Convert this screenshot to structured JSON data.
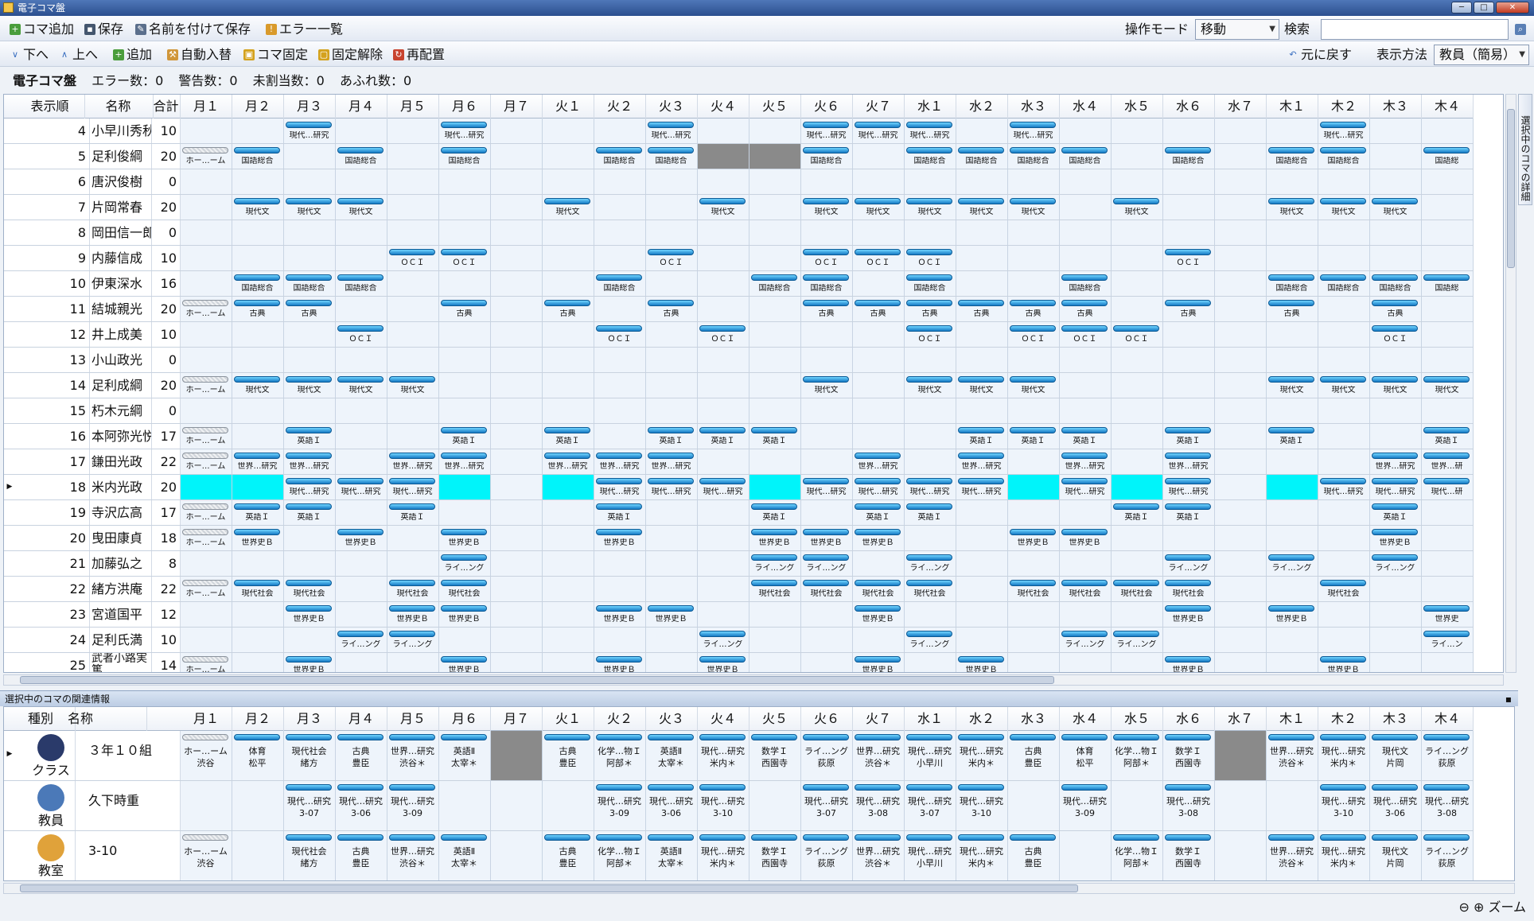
{
  "window": {
    "title": "電子コマ盤"
  },
  "toolbar1": {
    "add_piece": "コマ追加",
    "save": "保存",
    "save_as": "名前を付けて保存",
    "error_list": "エラー一覧",
    "mode_label": "操作モード",
    "mode_value": "移動",
    "search_label": "検索"
  },
  "toolbar2": {
    "down": "下へ",
    "up": "上へ",
    "add": "追加",
    "auto_swap": "自動入替",
    "lock": "コマ固定",
    "unlock": "固定解除",
    "rearrange": "再配置",
    "undo": "元に戻す",
    "display_label": "表示方法",
    "display_value": "教員（簡易）"
  },
  "status": {
    "name": "電子コマ盤",
    "errors": "エラー数：0",
    "warnings": "警告数：0",
    "unassigned": "未割当数：0",
    "overflow": "あふれ数：0"
  },
  "grid": {
    "col_order": "表示順",
    "col_name": "名称",
    "col_total": "合計",
    "periods": [
      "月１",
      "月２",
      "月３",
      "月４",
      "月５",
      "月６",
      "月７",
      "火１",
      "火２",
      "火３",
      "火４",
      "火５",
      "火６",
      "火７",
      "水１",
      "水２",
      "水３",
      "水４",
      "水５",
      "水６",
      "水７",
      "木１",
      "木２",
      "木３",
      "木４"
    ],
    "rows": [
      {
        "order": "4",
        "name": "小早川秀秋",
        "total": "10",
        "cells": {
          "2": "現代…研究",
          "5": "現代…研究",
          "9": "現代…研究",
          "12": "現代…研究",
          "13": "現代…研究",
          "14": "現代…研究",
          "16": "現代…研究",
          "22": "現代…研究"
        }
      },
      {
        "order": "5",
        "name": "足利俊綱",
        "total": "20",
        "cells": {
          "0": "ホー…ーム",
          "1": "国語総合",
          "3": "国語総合",
          "5": "国語総合",
          "8": "国語総合",
          "9": "国語総合",
          "12": "国語総合",
          "14": "国語総合",
          "15": "国語総合",
          "16": "国語総合",
          "17": "国語総合",
          "19": "国語総合",
          "21": "国語総合",
          "22": "国語総合",
          "24": "国語総"
        },
        "blocked": [
          10,
          11
        ]
      },
      {
        "order": "6",
        "name": "唐沢俊樹",
        "total": "0",
        "cells": {}
      },
      {
        "order": "7",
        "name": "片岡常春",
        "total": "20",
        "cells": {
          "1": "現代文",
          "2": "現代文",
          "3": "現代文",
          "7": "現代文",
          "10": "現代文",
          "12": "現代文",
          "13": "現代文",
          "14": "現代文",
          "15": "現代文",
          "16": "現代文",
          "18": "現代文",
          "21": "現代文",
          "22": "現代文",
          "23": "現代文"
        }
      },
      {
        "order": "8",
        "name": "岡田信一郎",
        "total": "0",
        "cells": {}
      },
      {
        "order": "9",
        "name": "内藤信成",
        "total": "10",
        "cells": {
          "4": "ＯＣＩ",
          "5": "ＯＣＩ",
          "9": "ＯＣＩ",
          "12": "ＯＣＩ",
          "13": "ＯＣＩ",
          "14": "ＯＣＩ",
          "19": "ＯＣＩ"
        }
      },
      {
        "order": "10",
        "name": "伊東深水",
        "total": "16",
        "cells": {
          "1": "国語総合",
          "2": "国語総合",
          "3": "国語総合",
          "8": "国語総合",
          "11": "国語総合",
          "12": "国語総合",
          "14": "国語総合",
          "17": "国語総合",
          "21": "国語総合",
          "22": "国語総合",
          "23": "国語総合",
          "24": "国語総"
        }
      },
      {
        "order": "11",
        "name": "結城親光",
        "total": "20",
        "cells": {
          "0": "ホー…ーム",
          "1": "古典",
          "2": "古典",
          "5": "古典",
          "7": "古典",
          "9": "古典",
          "12": "古典",
          "13": "古典",
          "14": "古典",
          "15": "古典",
          "16": "古典",
          "17": "古典",
          "19": "古典",
          "21": "古典",
          "23": "古典"
        }
      },
      {
        "order": "12",
        "name": "井上成美",
        "total": "10",
        "cells": {
          "3": "ＯＣＩ",
          "8": "ＯＣＩ",
          "10": "ＯＣＩ",
          "14": "ＯＣＩ",
          "16": "ＯＣＩ",
          "17": "ＯＣＩ",
          "18": "ＯＣＩ",
          "23": "ＯＣＩ"
        }
      },
      {
        "order": "13",
        "name": "小山政光",
        "total": "0",
        "cells": {}
      },
      {
        "order": "14",
        "name": "足利成綱",
        "total": "20",
        "cells": {
          "0": "ホー…ーム",
          "1": "現代文",
          "2": "現代文",
          "3": "現代文",
          "4": "現代文",
          "12": "現代文",
          "14": "現代文",
          "15": "現代文",
          "16": "現代文",
          "21": "現代文",
          "22": "現代文",
          "23": "現代文",
          "24": "現代文"
        }
      },
      {
        "order": "15",
        "name": "朽木元綱",
        "total": "0",
        "cells": {}
      },
      {
        "order": "16",
        "name": "本阿弥光悦",
        "total": "17",
        "cells": {
          "0": "ホー…ーム",
          "2": "英語Ｉ",
          "5": "英語Ｉ",
          "7": "英語Ｉ",
          "9": "英語Ｉ",
          "10": "英語Ｉ",
          "11": "英語Ｉ",
          "15": "英語Ｉ",
          "16": "英語Ｉ",
          "17": "英語Ｉ",
          "19": "英語Ｉ",
          "21": "英語Ｉ",
          "24": "英語Ｉ"
        }
      },
      {
        "order": "17",
        "name": "鎌田光政",
        "total": "22",
        "cells": {
          "0": "ホー…ーム",
          "1": "世界…研究",
          "2": "世界…研究",
          "4": "世界…研究",
          "5": "世界…研究",
          "7": "世界…研究",
          "8": "世界…研究",
          "9": "世界…研究",
          "13": "世界…研究",
          "15": "世界…研究",
          "17": "世界…研究",
          "19": "世界…研究",
          "23": "世界…研究",
          "24": "世界…研"
        }
      },
      {
        "order": "18",
        "name": "米内光政",
        "total": "20",
        "selected": true,
        "cells": {
          "2": "現代…研究",
          "3": "現代…研究",
          "4": "現代…研究",
          "8": "現代…研究",
          "9": "現代…研究",
          "10": "現代…研究",
          "12": "現代…研究",
          "13": "現代…研究",
          "14": "現代…研究",
          "15": "現代…研究",
          "17": "現代…研究",
          "19": "現代…研究",
          "22": "現代…研究",
          "23": "現代…研究",
          "24": "現代…研"
        },
        "cyan": [
          0,
          1,
          5,
          7,
          11,
          16,
          18,
          21
        ]
      },
      {
        "order": "19",
        "name": "寺沢広高",
        "total": "17",
        "cells": {
          "0": "ホー…ーム",
          "1": "英語Ｉ",
          "2": "英語Ｉ",
          "4": "英語Ｉ",
          "8": "英語Ｉ",
          "11": "英語Ｉ",
          "13": "英語Ｉ",
          "14": "英語Ｉ",
          "18": "英語Ｉ",
          "19": "英語Ｉ",
          "23": "英語Ｉ"
        }
      },
      {
        "order": "20",
        "name": "曳田康貞",
        "total": "18",
        "cells": {
          "0": "ホー…ーム",
          "1": "世界史Ｂ",
          "3": "世界史Ｂ",
          "5": "世界史Ｂ",
          "8": "世界史Ｂ",
          "11": "世界史Ｂ",
          "12": "世界史Ｂ",
          "13": "世界史Ｂ",
          "16": "世界史Ｂ",
          "17": "世界史Ｂ",
          "23": "世界史Ｂ"
        }
      },
      {
        "order": "21",
        "name": "加藤弘之",
        "total": "8",
        "cells": {
          "5": "ライ…ング",
          "11": "ライ…ング",
          "12": "ライ…ング",
          "14": "ライ…ング",
          "19": "ライ…ング",
          "21": "ライ…ング",
          "23": "ライ…ング"
        }
      },
      {
        "order": "22",
        "name": "緒方洪庵",
        "total": "22",
        "cells": {
          "0": "ホー…ーム",
          "1": "現代社会",
          "2": "現代社会",
          "4": "現代社会",
          "5": "現代社会",
          "11": "現代社会",
          "12": "現代社会",
          "13": "現代社会",
          "14": "現代社会",
          "16": "現代社会",
          "17": "現代社会",
          "18": "現代社会",
          "19": "現代社会",
          "22": "現代社会"
        }
      },
      {
        "order": "23",
        "name": "宮道国平",
        "total": "12",
        "cells": {
          "2": "世界史Ｂ",
          "4": "世界史Ｂ",
          "5": "世界史Ｂ",
          "8": "世界史Ｂ",
          "9": "世界史Ｂ",
          "13": "世界史Ｂ",
          "19": "世界史Ｂ",
          "21": "世界史Ｂ",
          "24": "世界史"
        }
      },
      {
        "order": "24",
        "name": "足利氏満",
        "total": "10",
        "cells": {
          "3": "ライ…ング",
          "4": "ライ…ング",
          "10": "ライ…ング",
          "14": "ライ…ング",
          "17": "ライ…ング",
          "18": "ライ…ング",
          "24": "ライ…ン"
        }
      },
      {
        "order": "25",
        "name": "武者小路実篤",
        "total": "14",
        "cells": {
          "0": "ホー…ーム",
          "2": "世界史Ｂ",
          "5": "世界史Ｂ",
          "8": "世界史Ｂ",
          "10": "世界史Ｂ",
          "13": "世界史Ｂ",
          "15": "世界史Ｂ",
          "19": "世界史Ｂ",
          "22": "世界史Ｂ"
        }
      }
    ]
  },
  "side_tab": "選択中のコマの詳細",
  "related": {
    "title": "選択中のコマの関連情報",
    "col_type": "種別",
    "col_name": "名称",
    "rows": [
      {
        "type": "クラス",
        "name": "３年１０組",
        "blocked": [
          6,
          20
        ],
        "cells": {
          "0": [
            "ホー…ーム",
            "渋谷"
          ],
          "1": [
            "体育",
            "松平"
          ],
          "2": [
            "現代社会",
            "緒方"
          ],
          "3": [
            "古典",
            "豊臣"
          ],
          "4": [
            "世界…研究",
            "渋谷＊"
          ],
          "5": [
            "英語Ⅱ",
            "太宰＊"
          ],
          "7": [
            "古典",
            "豊臣"
          ],
          "8": [
            "化学…物Ｉ",
            "阿部＊"
          ],
          "9": [
            "英語Ⅱ",
            "太宰＊"
          ],
          "10": [
            "現代…研究",
            "米内＊"
          ],
          "11": [
            "数学Ｉ",
            "西園寺"
          ],
          "12": [
            "ライ…ング",
            "荻原"
          ],
          "13": [
            "世界…研究",
            "渋谷＊"
          ],
          "14": [
            "現代…研究",
            "小早川"
          ],
          "15": [
            "現代…研究",
            "米内＊"
          ],
          "16": [
            "古典",
            "豊臣"
          ],
          "17": [
            "体育",
            "松平"
          ],
          "18": [
            "化学…物Ｉ",
            "阿部＊"
          ],
          "19": [
            "数学Ｉ",
            "西園寺"
          ],
          "21": [
            "世界…研究",
            "渋谷＊"
          ],
          "22": [
            "現代…研究",
            "米内＊"
          ],
          "23": [
            "現代文",
            "片岡"
          ],
          "24": [
            "ライ…ング",
            "荻原"
          ]
        }
      },
      {
        "type": "教員",
        "name": "久下時重",
        "blocked": [],
        "cells": {
          "2": [
            "現代…研究",
            "3-07"
          ],
          "3": [
            "現代…研究",
            "3-06"
          ],
          "4": [
            "現代…研究",
            "3-09"
          ],
          "8": [
            "現代…研究",
            "3-09"
          ],
          "9": [
            "現代…研究",
            "3-06"
          ],
          "10": [
            "現代…研究",
            "3-10"
          ],
          "12": [
            "現代…研究",
            "3-07"
          ],
          "13": [
            "現代…研究",
            "3-08"
          ],
          "14": [
            "現代…研究",
            "3-07"
          ],
          "15": [
            "現代…研究",
            "3-10"
          ],
          "17": [
            "現代…研究",
            "3-09"
          ],
          "19": [
            "現代…研究",
            "3-08"
          ],
          "22": [
            "現代…研究",
            "3-10"
          ],
          "23": [
            "現代…研究",
            "3-06"
          ],
          "24": [
            "現代…研究",
            "3-08"
          ]
        }
      },
      {
        "type": "教室",
        "name": "3-10",
        "blocked": [],
        "cells": {
          "0": [
            "ホー…ーム",
            "渋谷"
          ],
          "2": [
            "現代社会",
            "緒方"
          ],
          "3": [
            "古典",
            "豊臣"
          ],
          "4": [
            "世界…研究",
            "渋谷＊"
          ],
          "5": [
            "英語Ⅱ",
            "太宰＊"
          ],
          "7": [
            "古典",
            "豊臣"
          ],
          "8": [
            "化学…物Ｉ",
            "阿部＊"
          ],
          "9": [
            "英語Ⅱ",
            "太宰＊"
          ],
          "10": [
            "現代…研究",
            "米内＊"
          ],
          "11": [
            "数学Ｉ",
            "西園寺"
          ],
          "12": [
            "ライ…ング",
            "荻原"
          ],
          "13": [
            "世界…研究",
            "渋谷＊"
          ],
          "14": [
            "現代…研究",
            "小早川"
          ],
          "15": [
            "現代…研究",
            "米内＊"
          ],
          "16": [
            "古典",
            "豊臣"
          ],
          "18": [
            "化学…物Ｉ",
            "阿部＊"
          ],
          "19": [
            "数学Ｉ",
            "西園寺"
          ],
          "21": [
            "世界…研究",
            "渋谷＊"
          ],
          "22": [
            "現代…研究",
            "米内＊"
          ],
          "23": [
            "現代文",
            "片岡"
          ],
          "24": [
            "ライ…ング",
            "荻原"
          ]
        }
      }
    ]
  },
  "zoom_label": "ズーム",
  "colors": {
    "piece": "#1579c4",
    "selected_row": "#00f4fa",
    "blocked": "#8a8a8a"
  }
}
